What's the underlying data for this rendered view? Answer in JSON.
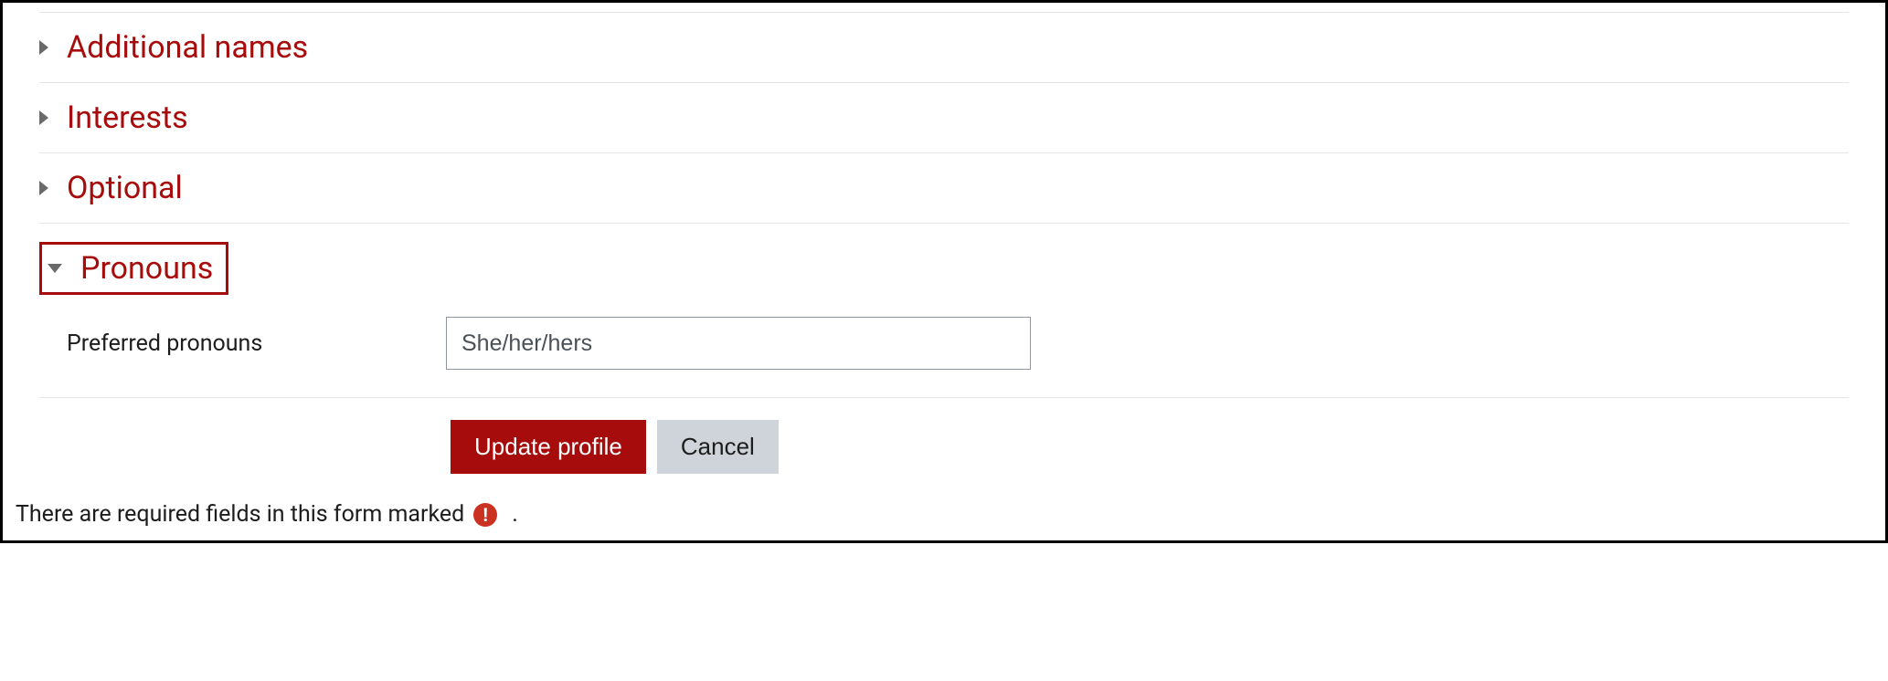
{
  "sections": {
    "additional_names": "Additional names",
    "interests": "Interests",
    "optional": "Optional",
    "pronouns": "Pronouns"
  },
  "fields": {
    "preferred_pronouns": {
      "label": "Preferred pronouns",
      "value": "She/her/hers"
    }
  },
  "buttons": {
    "update": "Update profile",
    "cancel": "Cancel"
  },
  "footer": {
    "text": "There are required fields in this form marked",
    "icon_glyph": "!",
    "period": "."
  }
}
